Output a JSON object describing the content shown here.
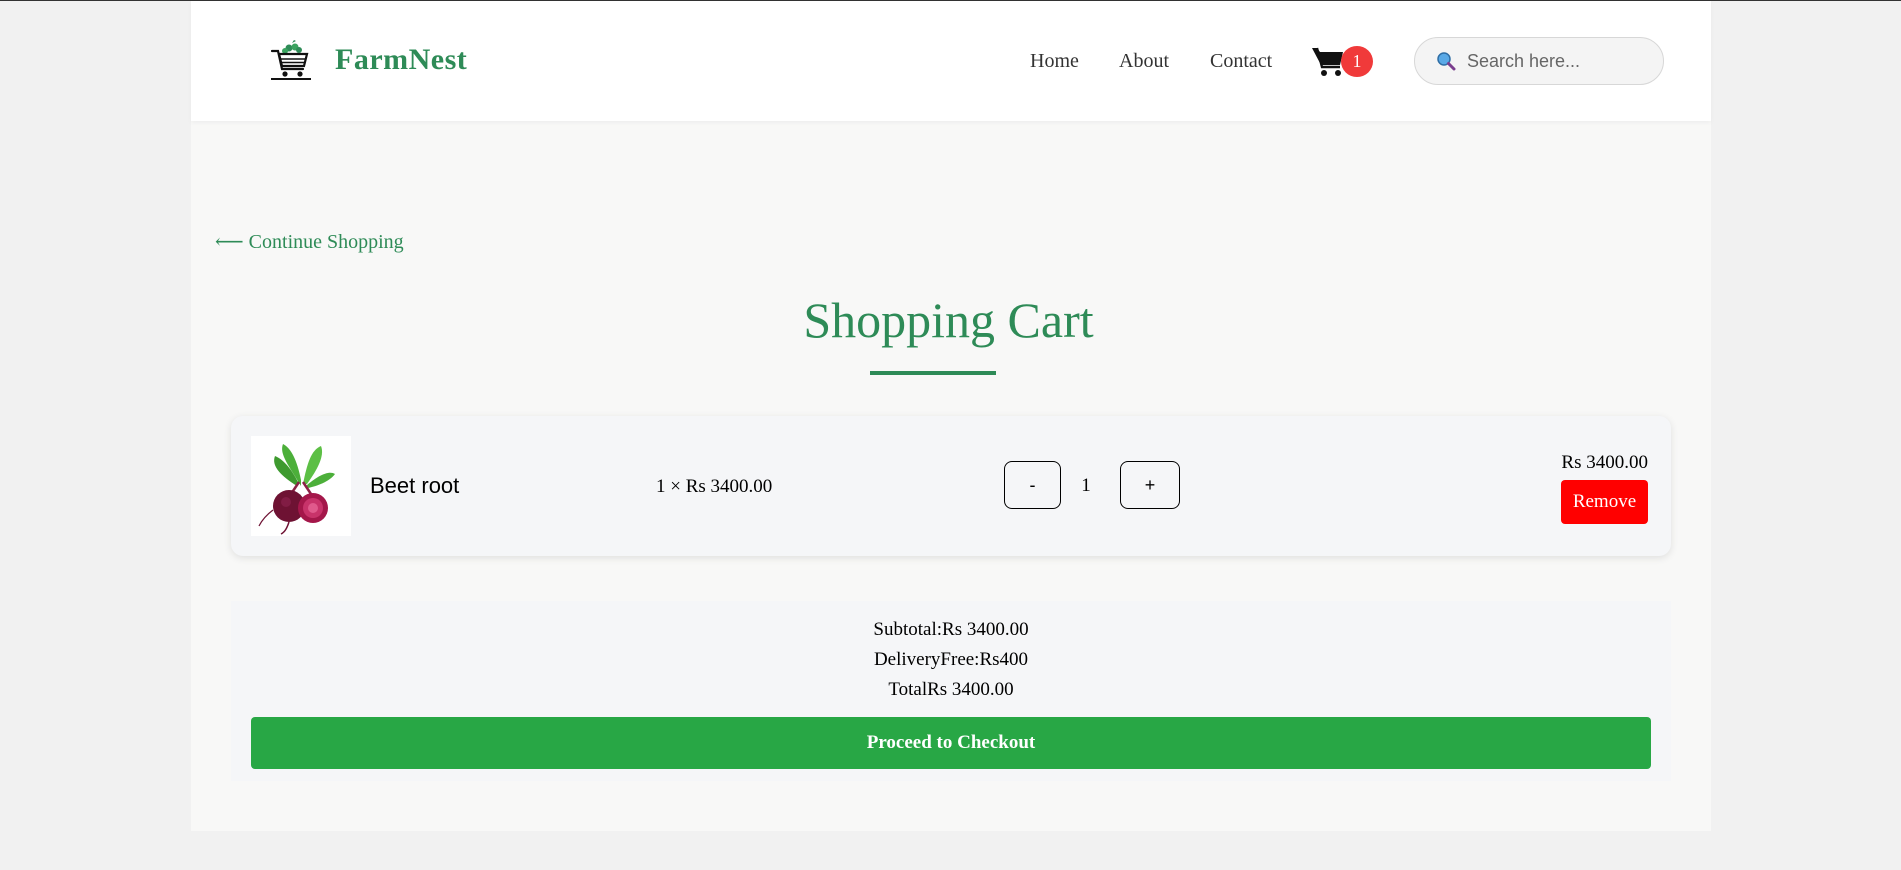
{
  "header": {
    "brand": "FarmNest",
    "nav": {
      "home": "Home",
      "about": "About",
      "contact": "Contact"
    },
    "cart_count": "1",
    "search_placeholder": "Search here..."
  },
  "back_link": "⟵ Continue Shopping",
  "page_title": "Shopping Cart",
  "cart_items": [
    {
      "name": "Beet root",
      "unit_line": "1 × Rs 3400.00",
      "qty": "1",
      "minus_label": "-",
      "plus_label": "+",
      "line_total": "Rs 3400.00",
      "remove_label": "Remove"
    }
  ],
  "summary": {
    "subtotal": "Subtotal:Rs 3400.00",
    "delivery": "DeliveryFree:Rs400",
    "total": "TotalRs 3400.00",
    "checkout_label": "Proceed to Checkout"
  },
  "colors": {
    "brand_green": "#2e8b57",
    "badge_red": "#f03a3a",
    "remove_red": "#ff0000",
    "checkout_green": "#28a745"
  },
  "icons": {
    "logo": "shopping-cart-vegetables-icon",
    "cart": "cart-icon",
    "search": "magnifier-icon",
    "product": "beetroot-image"
  }
}
